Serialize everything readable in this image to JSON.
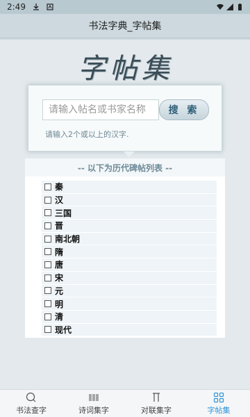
{
  "status_bar": {
    "time": "2:49"
  },
  "header": {
    "title": "书法字典_字帖集"
  },
  "logo": {
    "text": "字帖集"
  },
  "search": {
    "placeholder": "请输入帖名或书家名称",
    "button_label": "搜 索",
    "hint": "请输入2个或以上的汉字."
  },
  "list": {
    "heading": "-- 以下为历代碑帖列表 --",
    "items": [
      {
        "label": "秦",
        "checked": false
      },
      {
        "label": "汉",
        "checked": false
      },
      {
        "label": "三国",
        "checked": false
      },
      {
        "label": "晋",
        "checked": false
      },
      {
        "label": "南北朝",
        "checked": false
      },
      {
        "label": "隋",
        "checked": false
      },
      {
        "label": "唐",
        "checked": false
      },
      {
        "label": "宋",
        "checked": false
      },
      {
        "label": "元",
        "checked": false
      },
      {
        "label": "明",
        "checked": false
      },
      {
        "label": "清",
        "checked": false
      },
      {
        "label": "现代",
        "checked": false
      }
    ]
  },
  "bottom_nav": {
    "items": [
      {
        "label": "书法查字",
        "icon": "search-icon",
        "active": false
      },
      {
        "label": "诗词集字",
        "icon": "barcode-icon",
        "active": false
      },
      {
        "label": "对联集字",
        "icon": "couplet-icon",
        "active": false
      },
      {
        "label": "字帖集",
        "icon": "grid-icon",
        "active": true
      }
    ],
    "active_color": "#2f95d8"
  }
}
